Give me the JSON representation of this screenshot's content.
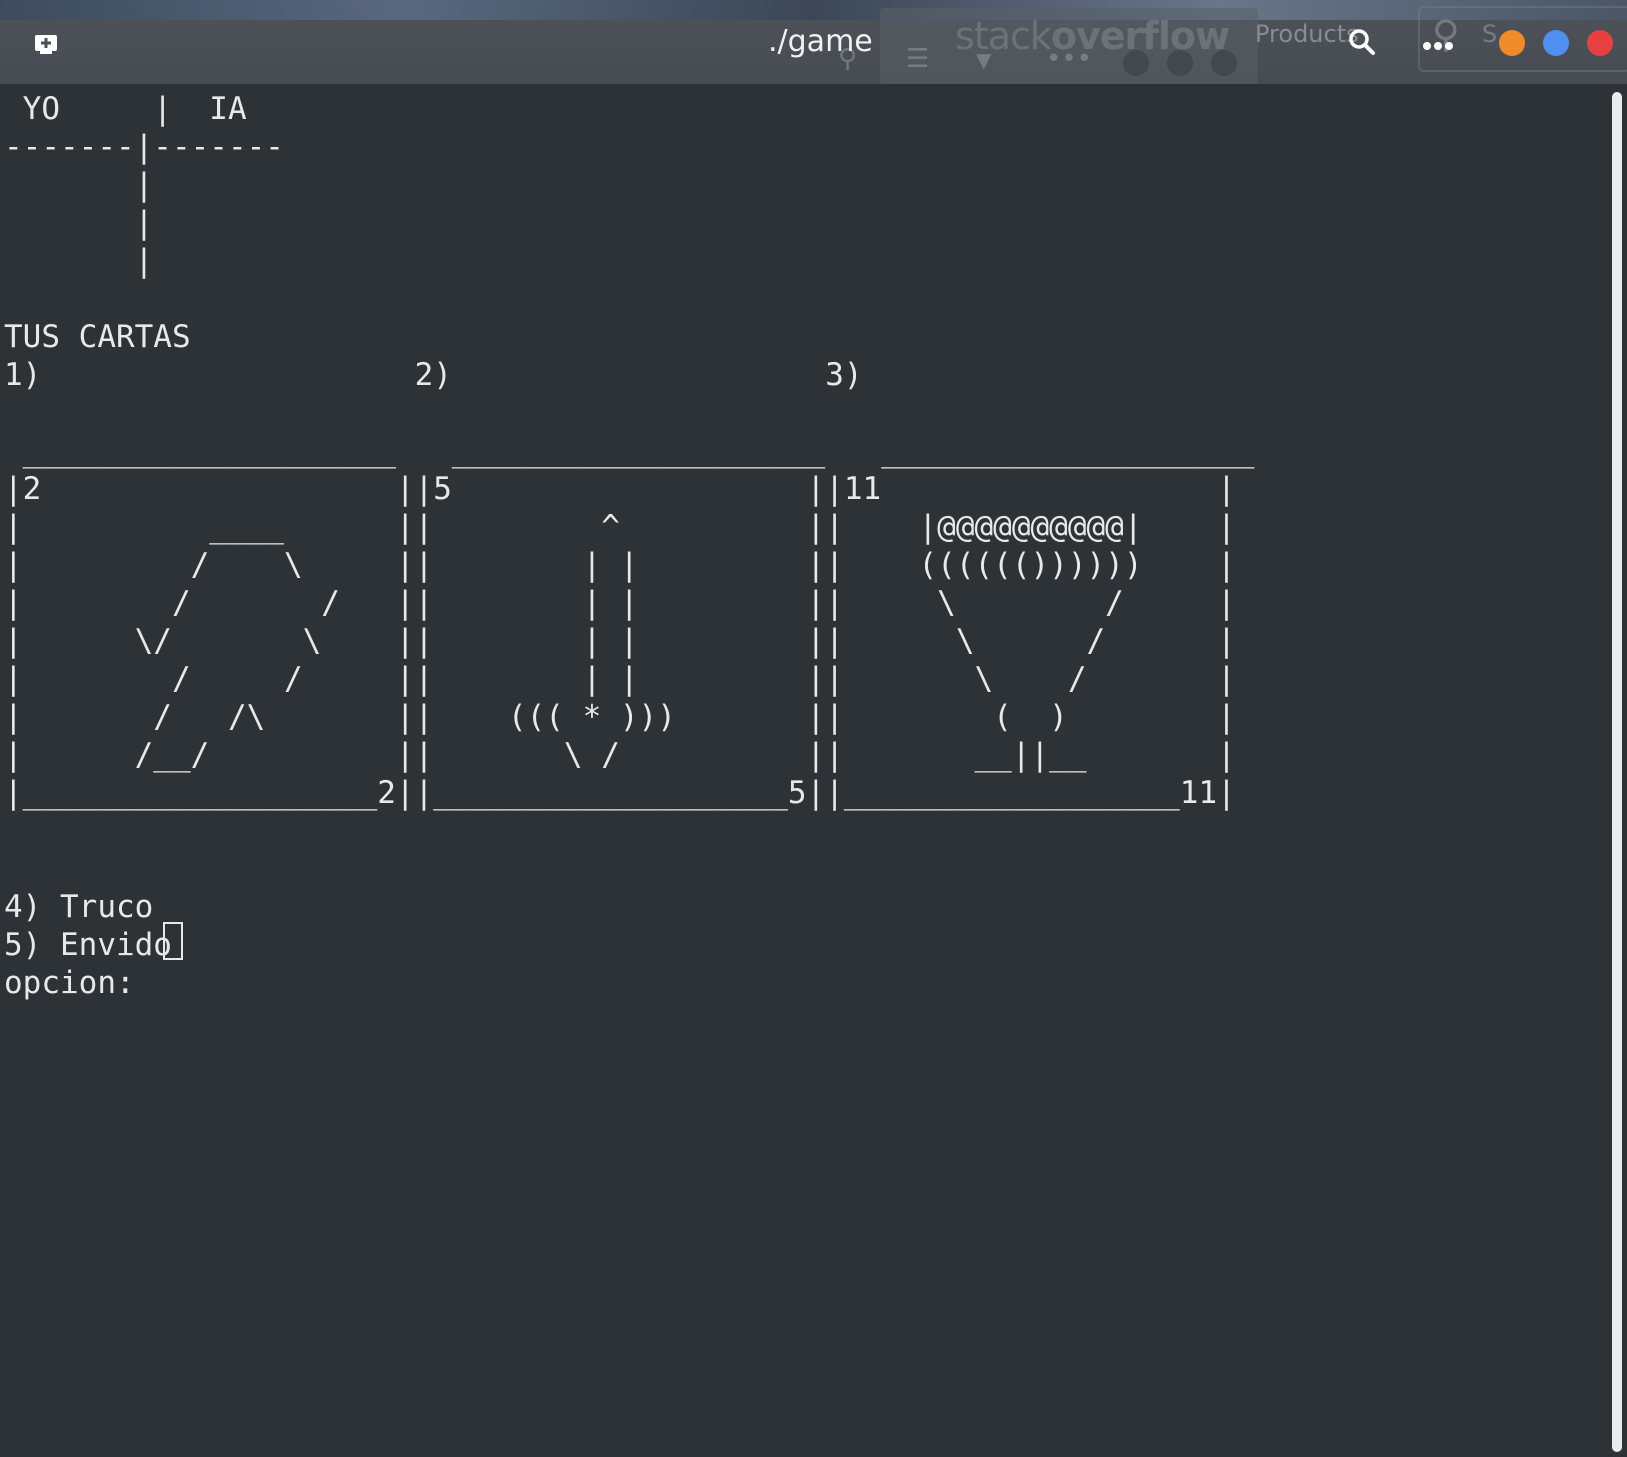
{
  "window": {
    "title": "./game"
  },
  "background": {
    "logo_light": "stack",
    "logo_bold": "overflow",
    "products_label": "Products",
    "search_label": "S"
  },
  "colors": {
    "terminal_bg": "#2d3236",
    "titlebar_bg": "#4d5358",
    "text": "#e8e8e8",
    "minimize": "#f08b2a",
    "maximize": "#4f8ff0",
    "close": "#e8403f"
  },
  "icons": {
    "new_tab": "new-tab-icon",
    "search": "search-icon",
    "menu": "menu-dots-icon"
  },
  "terminal": {
    "lines": [
      " YO     |  IA",
      "-------|-------",
      "       |",
      "       |",
      "       |",
      "",
      "TUS CARTAS",
      "1)                    2)                    3)",
      "",
      " ____________________   ____________________   ____________________",
      "|2                   ||5                   ||11                  |",
      "|          ____      ||         ^          ||    |@@@@@@@@@@|    |",
      "|         /    \\     ||        | |         ||    (((((())))))    |",
      "|        /       /   ||        | |         ||     \\        /     |",
      "|      \\/       \\    ||        | |         ||      \\      /      |",
      "|        /     /     ||        | |         ||       \\    /       |",
      "|       /   /\\       ||    ((( * )))       ||        (  )        |",
      "|      /__/          ||       \\ /          ||       __||__       |",
      "|___________________2||___________________5||__________________11|",
      "",
      "",
      "4) Truco",
      "5) Envido",
      "opcion: "
    ]
  }
}
